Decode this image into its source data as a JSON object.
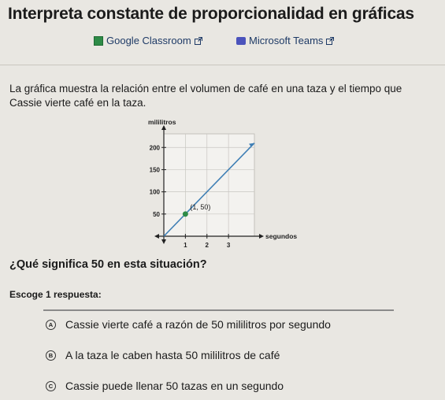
{
  "title": "Interpreta constante de proporcionalidad en gráficas",
  "links": {
    "google_classroom": "Google Classroom",
    "microsoft_teams": "Microsoft Teams"
  },
  "question": {
    "text": "La gráfica muestra la relación entre el volumen de café en una taza y el tiempo que Cassie vierte café en la taza.",
    "prompt": "¿Qué significa 50 en esta situación?",
    "choose_label": "Escoge 1 respuesta:"
  },
  "options": [
    {
      "letter": "A",
      "text": "Cassie vierte café a razón de 50 mililitros por segundo"
    },
    {
      "letter": "B",
      "text": "A la taza le caben hasta 50 mililitros de café"
    },
    {
      "letter": "C",
      "text": "Cassie puede llenar 50 tazas en un segundo"
    }
  ],
  "chart_data": {
    "type": "line",
    "ylabel": "mililitros",
    "xlabel": "segundos",
    "x_ticks": [
      "1",
      "2",
      "3"
    ],
    "y_ticks": [
      "50",
      "100",
      "150",
      "200"
    ],
    "xlim": [
      0,
      4.2
    ],
    "ylim": [
      0,
      220
    ],
    "grid": true,
    "series": [
      {
        "x": [
          0,
          4.2
        ],
        "y": [
          0,
          210
        ],
        "color": "#3f7fb5"
      }
    ],
    "point": {
      "x": 1,
      "y": 50,
      "label": "(1, 50)"
    }
  }
}
